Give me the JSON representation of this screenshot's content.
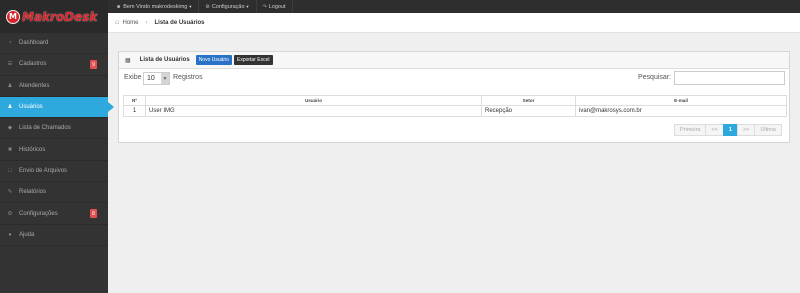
{
  "brand": {
    "logo_letter": "M",
    "name": "MakroDesk",
    "accent": "#d9232a"
  },
  "topmenu": {
    "welcome": "Bem Vindo makrodeskimg",
    "config": "Configuração",
    "logout": "Logout"
  },
  "sidebar": {
    "active_color": "#2ea9dd",
    "items": [
      {
        "label": "Dashboard",
        "icon": "dashboard-icon"
      },
      {
        "label": "Cadastros",
        "icon": "list-icon",
        "badge": "9"
      },
      {
        "label": "Atendentes",
        "icon": "users-icon"
      },
      {
        "label": "Usuários",
        "icon": "group-icon",
        "active": true
      },
      {
        "label": "Lista de Chamados",
        "icon": "tags-icon"
      },
      {
        "label": "Históricos",
        "icon": "history-icon"
      },
      {
        "label": "Envio de Arquivos",
        "icon": "file-icon"
      },
      {
        "label": "Relatórios",
        "icon": "edit-icon"
      },
      {
        "label": "Configurações",
        "icon": "gear-icon",
        "badge": "8"
      },
      {
        "label": "Ajuda",
        "icon": "help-icon"
      }
    ]
  },
  "breadcrumb": {
    "home": "Home",
    "current": "Lista de Usuários"
  },
  "panel": {
    "title": "Lista de Usuários",
    "new_button": "Novo Usuário",
    "export_button": "Exportar Excel"
  },
  "controls": {
    "show_label": "Exibe",
    "page_size": "10",
    "records_label": "Registros",
    "search_label": "Pesquisar:",
    "search_value": ""
  },
  "table": {
    "headers": [
      "Nº",
      "Usuário",
      "Setor",
      "E-mail"
    ],
    "rows": [
      [
        "1",
        "User IMG",
        "Recepção",
        "ivan@makrosys.com.br"
      ]
    ]
  },
  "pagination": {
    "first": "Primeira",
    "prev": "<<",
    "current": "1",
    "next": ">>",
    "last": "Última"
  }
}
